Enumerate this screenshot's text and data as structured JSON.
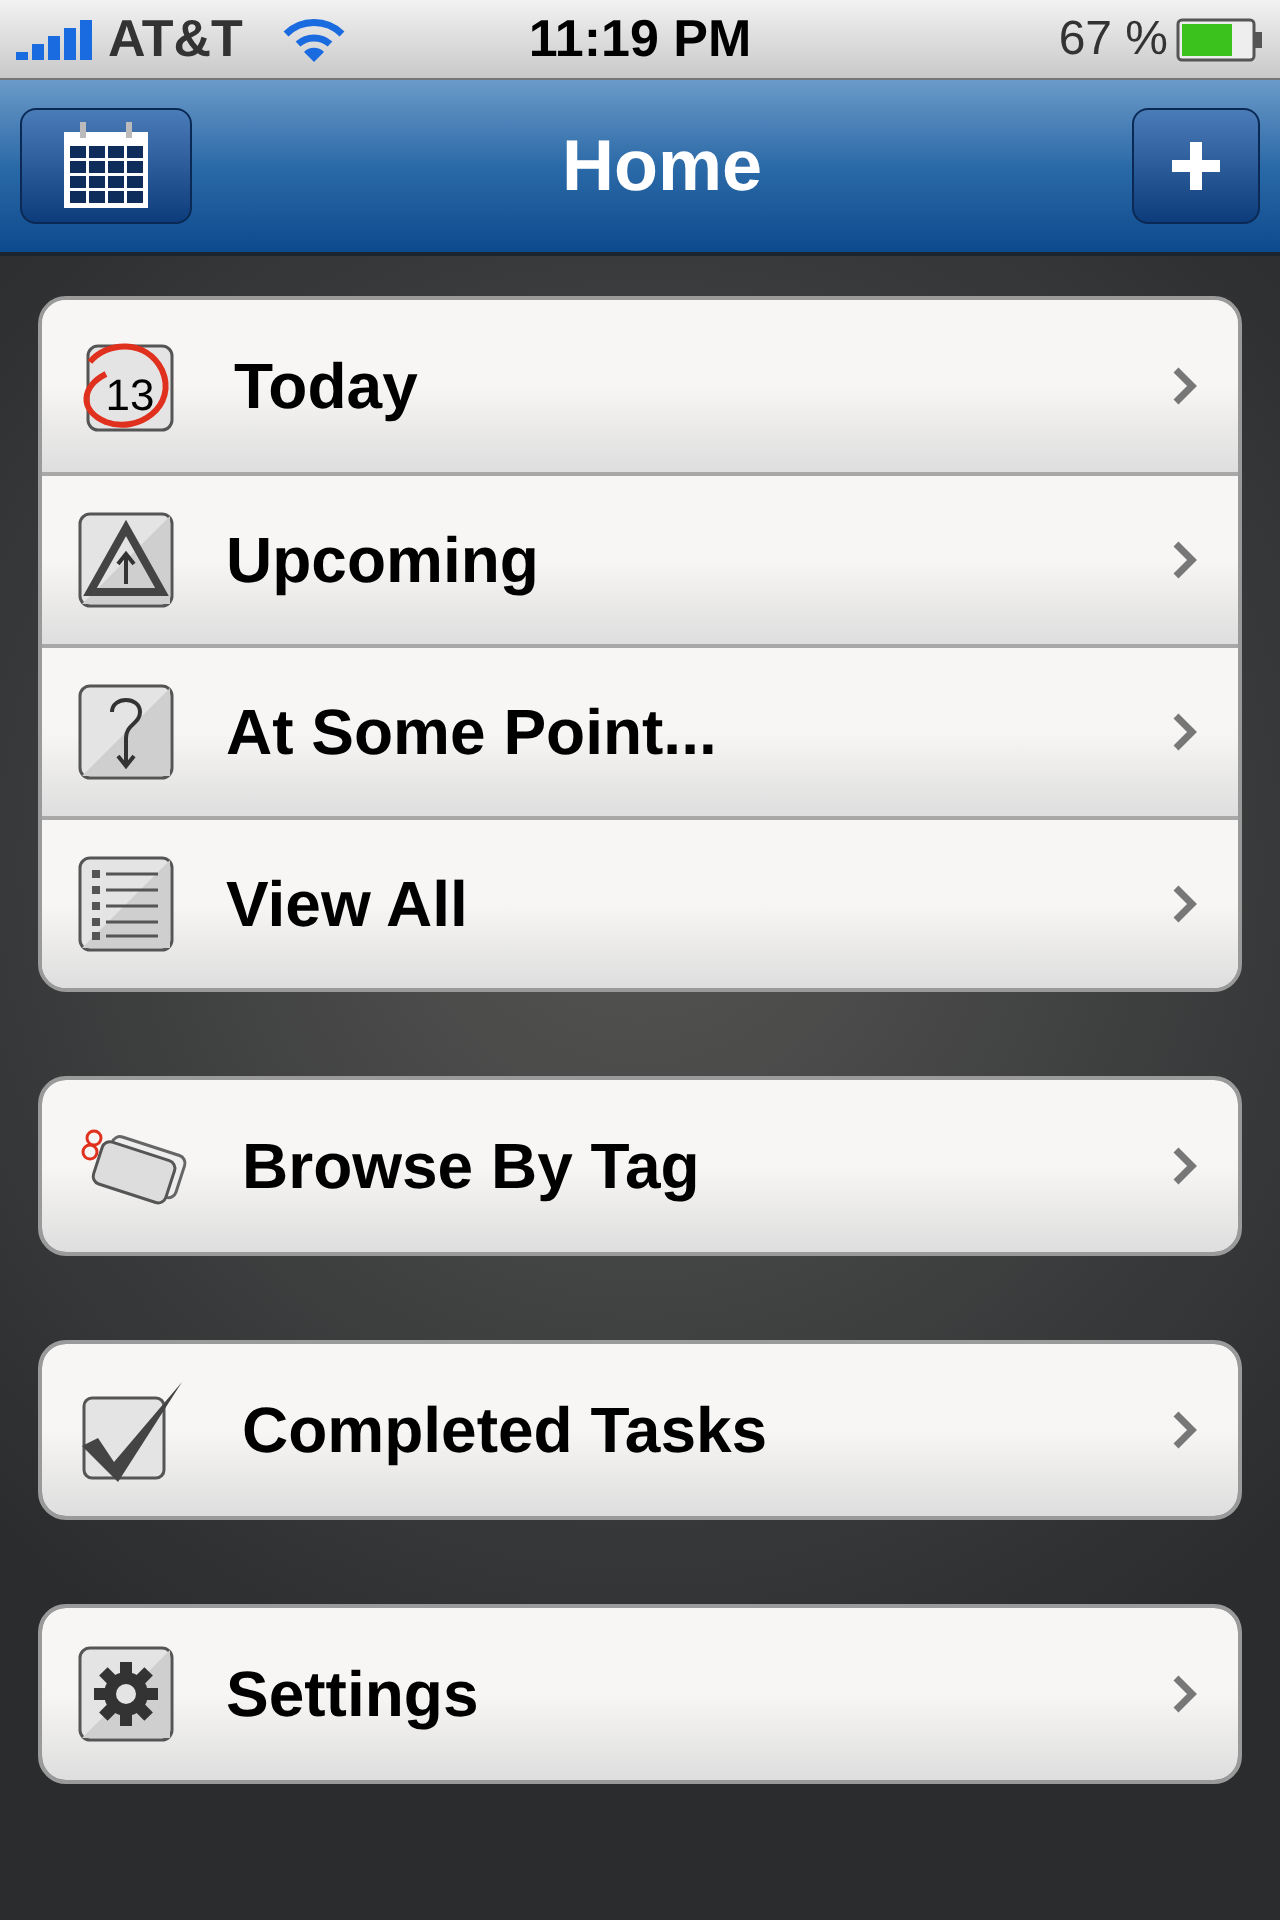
{
  "status_bar": {
    "carrier": "AT&T",
    "time": "11:19 PM",
    "battery": "67 %"
  },
  "nav_bar": {
    "title": "Home"
  },
  "groups": [
    {
      "items": [
        {
          "kind": "today",
          "label": "Today",
          "icon_text": "13"
        },
        {
          "kind": "upcoming",
          "label": "Upcoming"
        },
        {
          "kind": "someday",
          "label": "At Some Point..."
        },
        {
          "kind": "all",
          "label": "View All"
        }
      ]
    },
    {
      "items": [
        {
          "kind": "tag",
          "label": "Browse By Tag"
        }
      ]
    },
    {
      "items": [
        {
          "kind": "done",
          "label": "Completed Tasks"
        }
      ]
    },
    {
      "items": [
        {
          "kind": "settings",
          "label": "Settings"
        }
      ]
    }
  ]
}
